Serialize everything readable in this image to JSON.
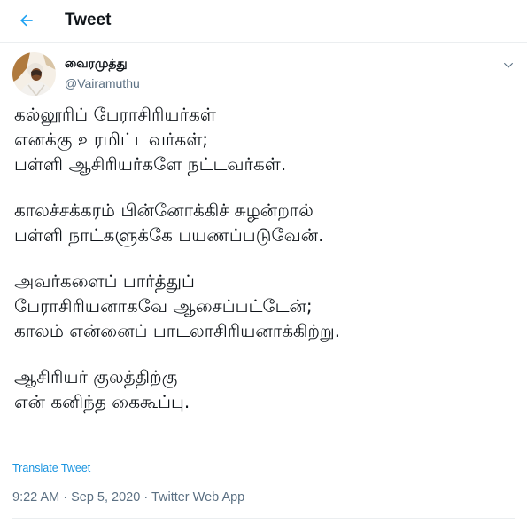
{
  "header": {
    "title": "Tweet"
  },
  "author": {
    "name": "வைரமுத்து",
    "handle": "@Vairamuthu"
  },
  "tweet": {
    "paragraphs": [
      [
        "கல்லூரிப் பேராசிரியர்கள்",
        "எனக்கு உரமிட்டவர்கள்;",
        "பள்ளி ஆசிரியர்களே நட்டவர்கள்."
      ],
      [
        "காலச்சக்கரம் பின்னோக்கிச் சுழன்றால்",
        "பள்ளி நாட்களுக்கே பயணப்படுவேன்."
      ],
      [
        "அவர்களைப் பார்த்துப்",
        "பேராசிரியனாகவே ஆசைப்பட்டேன்;",
        "காலம் என்னைப் பாடலாசிரியனாக்கிற்று."
      ],
      [
        "ஆசிரியர் குலத்திற்கு",
        "என் கனிந்த கைகூப்பு."
      ]
    ]
  },
  "translate_label": "Translate Tweet",
  "meta": {
    "time": "9:22 AM",
    "separator": " · ",
    "date": "Sep 5, 2020",
    "source": "Twitter Web App"
  },
  "colors": {
    "accent": "#1da1f2",
    "link": "#1b95e0",
    "secondary_text": "#5b7083",
    "divider": "#ebeef0"
  },
  "icons": {
    "back": "arrow-left-icon",
    "more": "chevron-down-icon"
  }
}
